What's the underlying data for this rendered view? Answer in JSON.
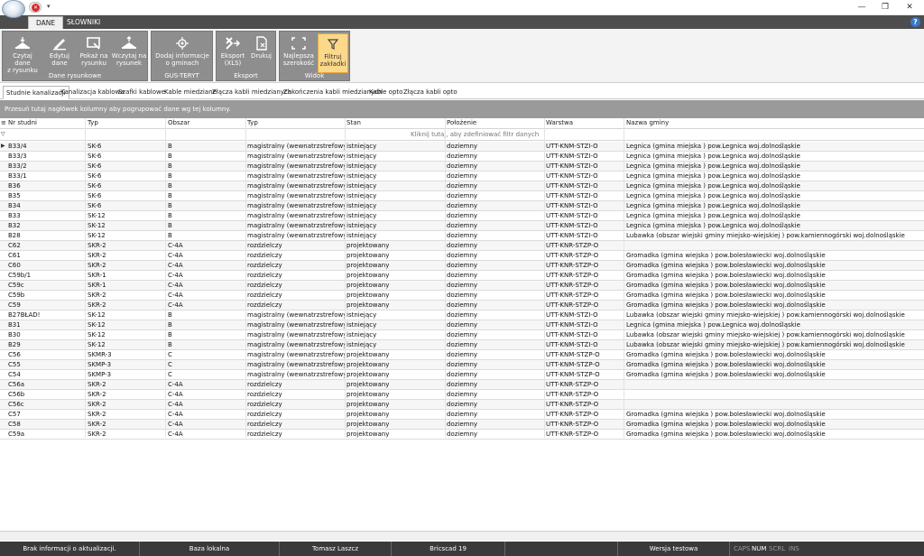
{
  "titlebar": {
    "close_glyph": "✕",
    "qa_arrow": "▾",
    "min_glyph": "—",
    "max_glyph": "❐",
    "close_win_glyph": "✕"
  },
  "ribbon_tabs": [
    {
      "label": "DANE",
      "active": true
    },
    {
      "label": "SŁOWNIKI",
      "active": false
    }
  ],
  "help_glyph": "?",
  "ribbon": {
    "groups": [
      {
        "label": "Dane rysunkowe",
        "buttons": [
          "Czytaj dane\nz rysunku",
          "Edytuj\ndane",
          "Pokaż na\nrysunku",
          "Wczytaj na\nrysunek"
        ]
      },
      {
        "label": "GUS-TERYT",
        "buttons": [
          "Dodaj informacje\no gminach"
        ]
      },
      {
        "label": "Eksport",
        "buttons": [
          "Eksport\n(XLS)",
          "Drukuj"
        ]
      },
      {
        "label": "Widok",
        "buttons": [
          "Najlepsza\nszerokość",
          "Filtruj\nzakładki"
        ]
      }
    ]
  },
  "sheet_tabs": [
    "Studnie kanalizacji",
    "Kanalizacja kablowa",
    "Szafki kablowe",
    "Kable miedziane",
    "Złącza kabli miedzianych",
    "Zakończenia kabli miedzianych",
    "Kable opto",
    "Złącza kabli opto"
  ],
  "group_panel_text": "Przesuń tutaj nagłówek kolumny aby pogrupować dane wg tej kolumny.",
  "grid": {
    "columns": [
      "Nr studni",
      "Typ",
      "Obszar",
      "Typ",
      "Stan",
      "Położenie",
      "Warstwa",
      "Nazwa gminy"
    ],
    "filter_hint": "Kliknij tutaj, aby zdefiniować filtr danych",
    "row_indicator": "▶",
    "filter_icon": "▽",
    "header_icon": "≡",
    "rows": [
      [
        "B33/4",
        "SK-6",
        "B",
        "magistralny (wewnatrzstrefowy)",
        "istniejący",
        "doziemny",
        "UTT-KNM-STZI-O",
        "Legnica (gmina miejska ) pow.Legnica woj.dolnośląskie"
      ],
      [
        "B33/3",
        "SK-6",
        "B",
        "magistralny (wewnatrzstrefowy)",
        "istniejący",
        "doziemny",
        "UTT-KNM-STZI-O",
        "Legnica (gmina miejska ) pow.Legnica woj.dolnośląskie"
      ],
      [
        "B33/2",
        "SK-6",
        "B",
        "magistralny (wewnatrzstrefowy)",
        "istniejący",
        "doziemny",
        "UTT-KNM-STZI-O",
        "Legnica (gmina miejska ) pow.Legnica woj.dolnośląskie"
      ],
      [
        "B33/1",
        "SK-6",
        "B",
        "magistralny (wewnatrzstrefowy)",
        "istniejący",
        "doziemny",
        "UTT-KNM-STZI-O",
        "Legnica (gmina miejska ) pow.Legnica woj.dolnośląskie"
      ],
      [
        "B36",
        "SK-6",
        "B",
        "magistralny (wewnatrzstrefowy)",
        "istniejący",
        "doziemny",
        "UTT-KNM-STZI-O",
        "Legnica (gmina miejska ) pow.Legnica woj.dolnośląskie"
      ],
      [
        "B35",
        "SK-6",
        "B",
        "magistralny (wewnatrzstrefowy)",
        "istniejący",
        "doziemny",
        "UTT-KNM-STZI-O",
        "Legnica (gmina miejska ) pow.Legnica woj.dolnośląskie"
      ],
      [
        "B34",
        "SK-6",
        "B",
        "magistralny (wewnatrzstrefowy)",
        "istniejący",
        "doziemny",
        "UTT-KNM-STZI-O",
        "Legnica (gmina miejska ) pow.Legnica woj.dolnośląskie"
      ],
      [
        "B33",
        "SK-12",
        "B",
        "magistralny (wewnatrzstrefowy)",
        "istniejący",
        "doziemny",
        "UTT-KNM-STZI-O",
        "Legnica (gmina miejska ) pow.Legnica woj.dolnośląskie"
      ],
      [
        "B32",
        "SK-12",
        "B",
        "magistralny (wewnatrzstrefowy)",
        "istniejący",
        "doziemny",
        "UTT-KNM-STZI-O",
        "Legnica (gmina miejska ) pow.Legnica woj.dolnośląskie"
      ],
      [
        "B28",
        "SK-12",
        "B",
        "magistralny (wewnatrzstrefowy)",
        "istniejący",
        "doziemny",
        "UTT-KNM-STZI-O",
        "Lubawka (obszar wiejski gminy miejsko-wiejskiej ) pow.kamiennogórski woj.dolnośląskie"
      ],
      [
        "C62",
        "SKR-2",
        "C-4A",
        "rozdzielczy",
        "projektowany",
        "doziemny",
        "UTT-KNR-STZP-O",
        ""
      ],
      [
        "C61",
        "SKR-2",
        "C-4A",
        "rozdzielczy",
        "projektowany",
        "doziemny",
        "UTT-KNR-STZP-O",
        "Gromadka (gmina wiejska ) pow.bolesławiecki woj.dolnośląskie"
      ],
      [
        "C60",
        "SKR-2",
        "C-4A",
        "rozdzielczy",
        "projektowany",
        "doziemny",
        "UTT-KNR-STZP-O",
        "Gromadka (gmina wiejska ) pow.bolesławiecki woj.dolnośląskie"
      ],
      [
        "C59b/1",
        "SKR-1",
        "C-4A",
        "rozdzielczy",
        "projektowany",
        "doziemny",
        "UTT-KNR-STZP-O",
        "Gromadka (gmina wiejska ) pow.bolesławiecki woj.dolnośląskie"
      ],
      [
        "C59c",
        "SKR-1",
        "C-4A",
        "rozdzielczy",
        "projektowany",
        "doziemny",
        "UTT-KNR-STZP-O",
        "Gromadka (gmina wiejska ) pow.bolesławiecki woj.dolnośląskie"
      ],
      [
        "C59b",
        "SKR-2",
        "C-4A",
        "rozdzielczy",
        "projektowany",
        "doziemny",
        "UTT-KNR-STZP-O",
        "Gromadka (gmina wiejska ) pow.bolesławiecki woj.dolnośląskie"
      ],
      [
        "C59",
        "SKR-2",
        "C-4A",
        "rozdzielczy",
        "projektowany",
        "doziemny",
        "UTT-KNR-STZP-O",
        "Gromadka (gmina wiejska ) pow.bolesławiecki woj.dolnośląskie"
      ],
      [
        "B27BŁAD!",
        "SK-12",
        "B",
        "magistralny (wewnatrzstrefowy)",
        "istniejący",
        "doziemny",
        "UTT-KNM-STZI-O",
        "Lubawka (obszar wiejski gminy miejsko-wiejskiej ) pow.kamiennogórski woj.dolnośląskie"
      ],
      [
        "B31",
        "SK-12",
        "B",
        "magistralny (wewnatrzstrefowy)",
        "istniejący",
        "doziemny",
        "UTT-KNM-STZI-O",
        "Legnica (gmina miejska ) pow.Legnica woj.dolnośląskie"
      ],
      [
        "B30",
        "SK-12",
        "B",
        "magistralny (wewnatrzstrefowy)",
        "istniejący",
        "doziemny",
        "UTT-KNM-STZI-O",
        "Lubawka (obszar wiejski gminy miejsko-wiejskiej ) pow.kamiennogórski woj.dolnośląskie"
      ],
      [
        "B29",
        "SK-12",
        "B",
        "magistralny (wewnatrzstrefowy)",
        "istniejący",
        "doziemny",
        "UTT-KNM-STZI-O",
        "Lubawka (obszar wiejski gminy miejsko-wiejskiej ) pow.kamiennogórski woj.dolnośląskie"
      ],
      [
        "C56",
        "SKMR-3",
        "C",
        "magistralny (wewnatrzstrefowy)",
        "projektowany",
        "doziemny",
        "UTT-KNM-STZP-O",
        "Gromadka (gmina wiejska ) pow.bolesławiecki woj.dolnośląskie"
      ],
      [
        "C55",
        "SKMP-3",
        "C",
        "magistralny (wewnatrzstrefowy)",
        "projektowany",
        "doziemny",
        "UTT-KNM-STZP-O",
        "Gromadka (gmina wiejska ) pow.bolesławiecki woj.dolnośląskie"
      ],
      [
        "C54",
        "SKMP-3",
        "C",
        "magistralny (wewnatrzstrefowy)",
        "projektowany",
        "doziemny",
        "UTT-KNM-STZP-O",
        "Gromadka (gmina wiejska ) pow.bolesławiecki woj.dolnośląskie"
      ],
      [
        "C56a",
        "SKR-2",
        "C-4A",
        "rozdzielczy",
        "projektowany",
        "doziemny",
        "UTT-KNR-STZP-O",
        ""
      ],
      [
        "C56b",
        "SKR-2",
        "C-4A",
        "rozdzielczy",
        "projektowany",
        "doziemny",
        "UTT-KNR-STZP-O",
        ""
      ],
      [
        "C56c",
        "SKR-2",
        "C-4A",
        "rozdzielczy",
        "projektowany",
        "doziemny",
        "UTT-KNR-STZP-O",
        ""
      ],
      [
        "C57",
        "SKR-2",
        "C-4A",
        "rozdzielczy",
        "projektowany",
        "doziemny",
        "UTT-KNR-STZP-O",
        "Gromadka (gmina wiejska ) pow.bolesławiecki woj.dolnośląskie"
      ],
      [
        "C58",
        "SKR-2",
        "C-4A",
        "rozdzielczy",
        "projektowany",
        "doziemny",
        "UTT-KNR-STZP-O",
        "Gromadka (gmina wiejska ) pow.bolesławiecki woj.dolnośląskie"
      ],
      [
        "C59a",
        "SKR-2",
        "C-4A",
        "rozdzielczy",
        "projektowany",
        "doziemny",
        "UTT-KNR-STZP-O",
        "Gromadka (gmina wiejska ) pow.bolesławiecki woj.dolnośląskie"
      ]
    ]
  },
  "statusbar": {
    "cells": [
      "Brak informacji o aktualizacji.",
      "Baza lokalna",
      "Tomasz Laszcz",
      "Bricscad 19",
      "",
      "Wersja testowa"
    ],
    "keys": [
      {
        "label": "CAPS",
        "on": false
      },
      {
        "label": "NUM",
        "on": true
      },
      {
        "label": "SCRL",
        "on": false
      },
      {
        "label": "INS",
        "on": false
      }
    ]
  }
}
